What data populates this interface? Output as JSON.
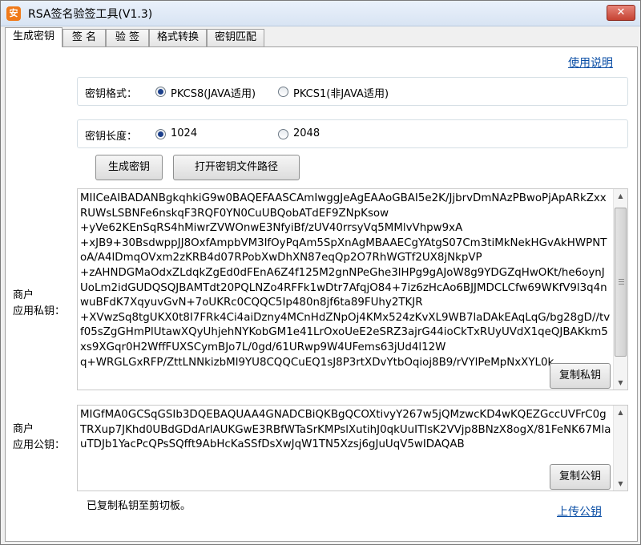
{
  "window": {
    "title": "RSA签名验签工具(V1.3)",
    "close_glyph": "✕",
    "icon_text": "安"
  },
  "tabs": [
    {
      "label": "生成密钥",
      "active": true
    },
    {
      "label": "签 名",
      "active": false
    },
    {
      "label": "验 签",
      "active": false
    },
    {
      "label": "格式转换",
      "active": false
    },
    {
      "label": "密钥匹配",
      "active": false
    }
  ],
  "help_link": "使用说明",
  "key_format": {
    "label": "密钥格式：",
    "options": [
      {
        "label": "PKCS8(JAVA适用)",
        "checked": true
      },
      {
        "label": "PKCS1(非JAVA适用)",
        "checked": false
      }
    ]
  },
  "key_length": {
    "label": "密钥长度：",
    "options": [
      {
        "label": "1024",
        "checked": true
      },
      {
        "label": "2048",
        "checked": false
      }
    ]
  },
  "buttons": {
    "generate": "生成密钥",
    "open_path": "打开密钥文件路径",
    "copy_private": "复制私钥",
    "copy_public": "复制公钥"
  },
  "private_key": {
    "label": "商户\n应用私钥：",
    "value": "MIICeAIBADANBgkqhkiG9w0BAQEFAASCAmIwggJeAgEAAoGBAI5e2K/JjbrvDmNAzPBwoPjApARkZxxRUWsLSBNFe6nskqF3RQF0YN0CuUBQobATdEF9ZNpKsow\n+yVe62KEnSqRS4hMiwrZVWOnwE3NfyiBf/zUV40rrsyVq5MMlvVhpw9xA\n+xJB9+30BsdwppJJ8OxfAmpbVM3lfOyPqAm5SpXnAgMBAAECgYAtgS07Cm3tiMkNekHGvAkHWPNToA/A4lDmqOVxm2zKRB4d07RPobXwDhXN87eqQp2O7RhWGTf2UX8jNkpVP\n+zAHNDGMaOdxZLdqkZgEd0dFEnA6Z4f125M2gnNPeGhe3lHPg9gAJoW8g9YDGZqHwOKt/he6oynJUoLm2idGUDQSQJBAMTdt20PQLNZo4RFFk1wDtr7AfqjO84+7iz6zHcAo6BJJMDCLCfw69WKfV9l3q4nwuBFdK7XqyuvGvN+7oUKRc0CQQC5Ip480n8jf6ta89FUhy2TKJR\n+XVwzSq8tgUKX0t8I7FRk4Ci4aiDzny4MCnHdZNpOj4KMx524zKvXL9WB7laDAkEAqLqG/bg28gD//tvf05sZgGHmPlUtawXQyUhjehNYKobGM1e41LrOxoUeE2eSRZ3ajrG44ioCkTxRUyUVdX1qeQJBAKkm5xs9XGqr0H2WffFUXSCymBJo7L/0gd/61URwp9W4UFems63jUd4l12W\nq+WRGLGxRFP/ZttLNNkizbMl9YU8CQQCuEQ1sJ8P3rtXDvYtbOqioj8B9/rVYlPeMpNxXYL0k"
  },
  "public_key": {
    "label": "商户\n应用公钥：",
    "value": "MIGfMA0GCSqGSIb3DQEBAQUAA4GNADCBiQKBgQCOXtivyY267w5jQMzwcKD4wKQEZGccUVFrC0gTRXup7JKhd0UBdGDdArlAUKGwE3RBfWTaSrKMPslXutihJ0qkUuITIsK2VVjp8BNzX8ogX/81FeNK67MlauTDJb1YacPcQPsSQfft9AbHcKaSSfDsXwJqW1TN5Xzsj6gJuUqV5wIDAQAB"
  },
  "status": "已复制私钥至剪切板。",
  "upload_link": "上传公钥"
}
